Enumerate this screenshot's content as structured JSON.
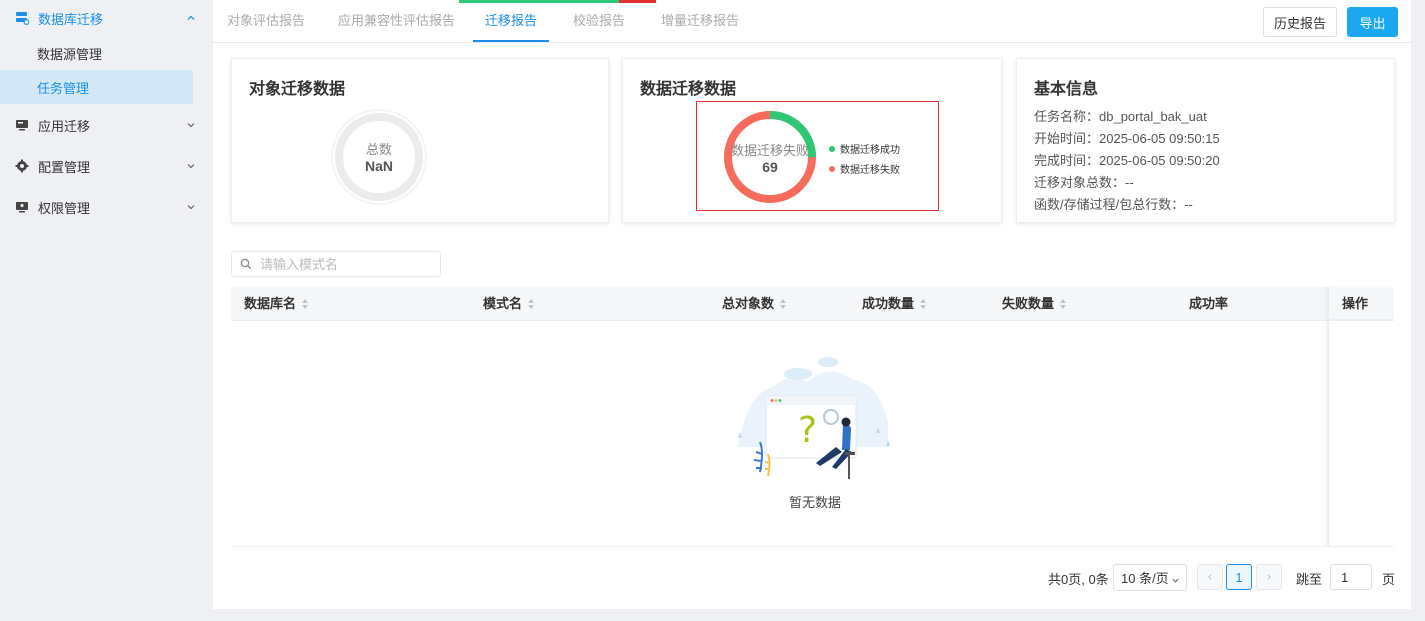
{
  "sidebar": {
    "groups": [
      {
        "label": "数据库迁移",
        "icon": "database-icon",
        "expanded": true
      },
      {
        "label": "应用迁移",
        "icon": "monitor-icon",
        "expanded": false
      },
      {
        "label": "配置管理",
        "icon": "gear-icon",
        "expanded": false
      },
      {
        "label": "权限管理",
        "icon": "monitor-user-icon",
        "expanded": false
      }
    ],
    "sub_items": [
      {
        "label": "数据源管理",
        "active": false
      },
      {
        "label": "任务管理",
        "active": true
      }
    ]
  },
  "tabs": [
    {
      "label": "对象评估报告",
      "active": false
    },
    {
      "label": "应用兼容性评估报告",
      "active": false
    },
    {
      "label": "迁移报告",
      "active": true
    },
    {
      "label": "校验报告",
      "active": false
    },
    {
      "label": "增量迁移报告",
      "active": false
    }
  ],
  "toolbar": {
    "history_label": "历史报告",
    "export_label": "导出"
  },
  "object_card": {
    "title": "对象迁移数据",
    "total_label": "总数",
    "total_value": "NaN"
  },
  "data_card": {
    "title": "数据迁移数据",
    "center_label": "数据迁移失败",
    "center_value": "69",
    "legend": [
      {
        "label": "数据迁移成功",
        "color": "#2ec776"
      },
      {
        "label": "数据迁移失败",
        "color": "#f56c5c"
      }
    ],
    "success_fraction": 0.25
  },
  "info_card": {
    "title": "基本信息",
    "lines": [
      "任务名称：db_portal_bak_uat",
      "开始时间：2025-06-05 09:50:15",
      "完成时间：2025-06-05 09:50:20",
      "迁移对象总数：--",
      "函数/存储过程/包总行数：--"
    ]
  },
  "search": {
    "placeholder": "请输入模式名"
  },
  "table": {
    "columns": [
      "数据库名",
      "模式名",
      "总对象数",
      "成功数量",
      "失败数量",
      "成功率"
    ],
    "action_column": "操作",
    "empty_text": "暂无数据"
  },
  "pagination": {
    "total_text": "共0页, 0条",
    "page_size": "10 条/页",
    "current_page": "1",
    "jump_label": "跳至",
    "jump_value": "1",
    "page_suffix": "页"
  },
  "colors": {
    "accent": "#1a8fe8",
    "primary_button": "#1aa8f0",
    "success": "#2ec776",
    "fail": "#f56c5c",
    "highlight_border": "#e03030"
  }
}
